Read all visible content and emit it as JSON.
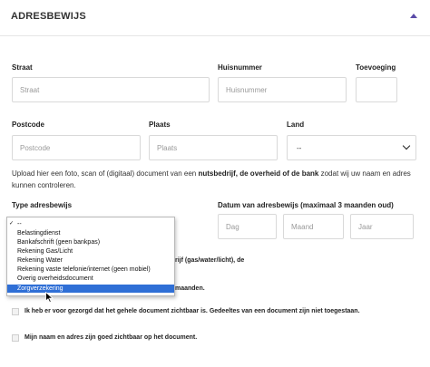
{
  "section": {
    "title": "ADRESBEWIJS"
  },
  "fields": {
    "street": {
      "label": "Straat",
      "placeholder": "Straat"
    },
    "house_number": {
      "label": "Huisnummer",
      "placeholder": "Huisnummer"
    },
    "addition": {
      "label": "Toevoeging",
      "placeholder": ""
    },
    "postcode": {
      "label": "Postcode",
      "placeholder": "Postcode"
    },
    "city": {
      "label": "Plaats",
      "placeholder": "Plaats"
    },
    "country": {
      "label": "Land",
      "value": "--"
    }
  },
  "upload_text": {
    "part1": "Upload hier een foto, scan of (digitaal) document van een ",
    "bold": "nutsbedrijf, de overheid of de bank",
    "part2": " zodat wij uw naam en adres kunnen controleren."
  },
  "document_type": {
    "label": "Type adresbewijs",
    "options": [
      "--",
      "Belastingdienst",
      "Bankafschrift (geen bankpas)",
      "Rekening Gas/Licht",
      "Rekening Water",
      "Rekening vaste telefonie/internet (geen mobiel)",
      "Overig overheidsdocument",
      "Zorgverzekering"
    ],
    "checked_option": "--",
    "highlighted_option": "Zorgverzekering",
    "check_mark": "✓"
  },
  "document_date": {
    "label": "Datum van adresbewijs (maximaal 3 maanden oud)",
    "day_placeholder": "Dag",
    "month_placeholder": "Maand",
    "year_placeholder": "Jaar"
  },
  "checks": {
    "partial_1": "rijf (gas/water/licht), de",
    "partial_2": "maanden.",
    "item_3": "Ik heb er voor gezorgd dat het gehele document zichtbaar is. Gedeeltes van een document zijn niet toegestaan.",
    "item_4": "Mijn naam en adres zijn goed zichtbaar op het document."
  },
  "colors": {
    "accent": "#5a4ba8",
    "selected_option": "#2f6fd6",
    "input_border": "#d9d9d9"
  }
}
